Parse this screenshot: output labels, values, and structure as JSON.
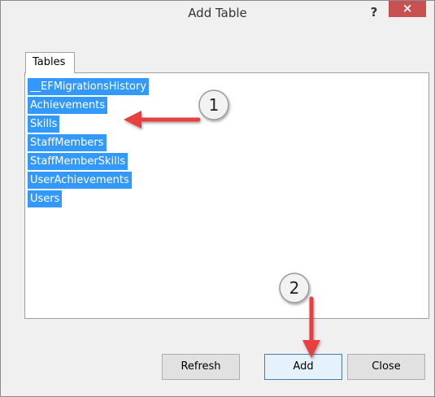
{
  "window": {
    "title": "Add Table",
    "help_label": "?",
    "close_label": "×"
  },
  "tabs": [
    {
      "label": "Tables"
    }
  ],
  "tables_list": {
    "items": [
      "__EFMigrationsHistory",
      "Achievements",
      "Skills",
      "StaffMembers",
      "StaffMemberSkills",
      "UserAchievements",
      "Users"
    ]
  },
  "buttons": {
    "refresh_label": "Refresh",
    "add_label": "Add",
    "close_label": "Close"
  },
  "annotations": [
    {
      "number": "1"
    },
    {
      "number": "2"
    }
  ],
  "colors": {
    "selection": "#3399ff",
    "annotation_arrow": "#e84040",
    "close_button": "#c75050"
  }
}
